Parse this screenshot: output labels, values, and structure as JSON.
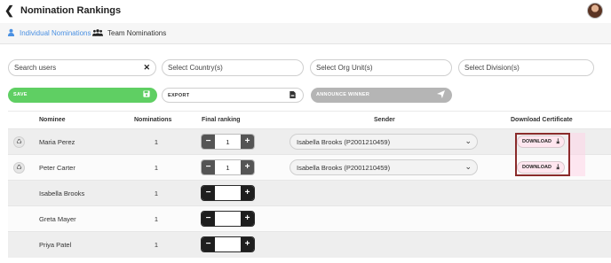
{
  "header": {
    "back_icon": "chevron-left-icon",
    "title": "Nomination Rankings",
    "avatar_icon": "user-avatar"
  },
  "tabs": [
    {
      "label": "Individual Nominations",
      "icon": "person-icon",
      "active": true
    },
    {
      "label": "Team Nominations",
      "icon": "group-icon",
      "active": false
    }
  ],
  "filters": {
    "search": {
      "placeholder": "Search users",
      "value": ""
    },
    "country": {
      "placeholder": "Select Country(s)"
    },
    "org_unit": {
      "placeholder": "Select Org Unit(s)"
    },
    "division": {
      "placeholder": "Select Division(s)"
    }
  },
  "actions": {
    "save": "SAVE",
    "export": "EXPORT",
    "announce": "ANNOUNCE WINNER"
  },
  "table": {
    "columns": [
      "Nominee",
      "Nominations",
      "Final ranking",
      "Sender",
      "Download Certificate"
    ],
    "download_label": "DOWNLOAD",
    "rows": [
      {
        "nominee": "Maria Perez",
        "nominations": "1",
        "ranking": "1",
        "sender": "Isabella Brooks (P2001210459)",
        "has_trophy": true,
        "has_download": true
      },
      {
        "nominee": "Peter Carter",
        "nominations": "1",
        "ranking": "1",
        "sender": "Isabella Brooks (P2001210459)",
        "has_trophy": true,
        "has_download": true
      },
      {
        "nominee": "Isabella Brooks",
        "nominations": "1",
        "ranking": "",
        "sender": "",
        "has_trophy": false,
        "has_download": false
      },
      {
        "nominee": "Greta Mayer",
        "nominations": "1",
        "ranking": "",
        "sender": "",
        "has_trophy": false,
        "has_download": false
      },
      {
        "nominee": "Priya Patel",
        "nominations": "1",
        "ranking": "",
        "sender": "",
        "has_trophy": false,
        "has_download": false
      }
    ]
  },
  "colors": {
    "accent_blue": "#4a90e2",
    "save_green": "#5fcf63",
    "announce_gray": "#b5b5b5",
    "highlight_border": "#8a2b2b"
  }
}
